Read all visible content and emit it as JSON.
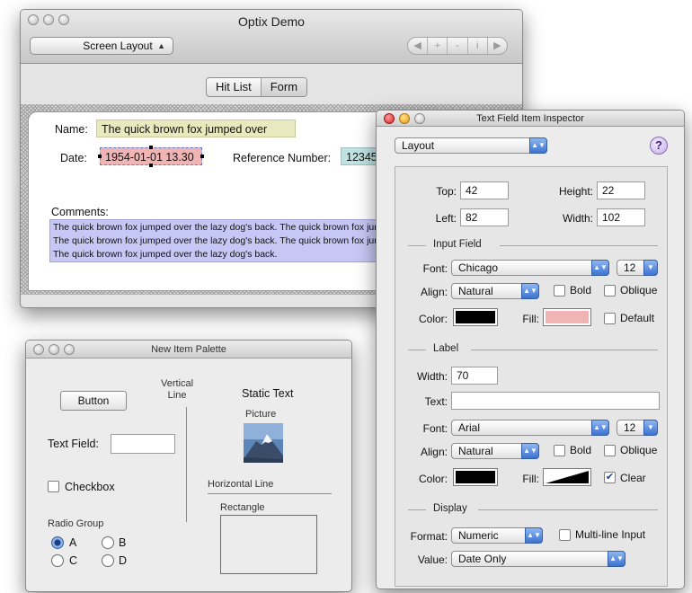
{
  "main": {
    "title": "Optix Demo",
    "layout_popup": "Screen Layout",
    "nav_segments": [
      "◀",
      "+",
      "-",
      "i",
      "▶"
    ],
    "tabs": [
      "Hit List",
      "Form"
    ],
    "form": {
      "name_label": "Name:",
      "name_value": "The quick brown fox jumped over",
      "date_label": "Date:",
      "date_value": "1954-01-01 13.30",
      "ref_label": "Reference Number:",
      "ref_value": "12345",
      "comments_label": "Comments:",
      "comments_value": "The quick brown fox jumped over the lazy dog's back.  The quick brown fox jumped over the lazy dog's back.  The quick brown fox jumped over the lazy dog's back.  The quick brown fox jumped over the lazy dog's back.  The quick brown fox jumped over the lazy dog's back."
    }
  },
  "palette": {
    "title": "New Item Palette",
    "button_label": "Button",
    "vertical_line": "Vertical\nLine",
    "static_text": "Static Text",
    "picture_label": "Picture",
    "text_field_label": "Text Field:",
    "checkbox_label": "Checkbox",
    "horizontal_line": "Horizontal Line",
    "radio_group": "Radio Group",
    "radio_a": "A",
    "radio_b": "B",
    "radio_c": "C",
    "radio_d": "D",
    "rectangle_label": "Rectangle"
  },
  "inspector": {
    "title": "Text Field Item Inspector",
    "mode_popup": "Layout",
    "help": "?",
    "top_label": "Top:",
    "top_value": "42",
    "height_label": "Height:",
    "height_value": "22",
    "left_label": "Left:",
    "left_value": "82",
    "width_label": "Width:",
    "width_value": "102",
    "input_section": "Input Field",
    "font_label": "Font:",
    "input_font": "Chicago",
    "input_size": "12",
    "align_label": "Align:",
    "input_align": "Natural",
    "bold_label": "Bold",
    "oblique_label": "Oblique",
    "color_label": "Color:",
    "fill_label": "Fill:",
    "default_label": "Default",
    "label_section": "Label",
    "label_width_label": "Width:",
    "label_width_value": "70",
    "text_label": "Text:",
    "text_value": "",
    "label_font": "Arial",
    "label_size": "12",
    "label_align": "Natural",
    "clear_label": "Clear",
    "display_section": "Display",
    "format_label": "Format:",
    "format_value": "Numeric",
    "multiline_label": "Multi-line Input",
    "value_label": "Value:",
    "value_value": "Date Only",
    "colors": {
      "input_color": "#000000",
      "input_fill": "#f0b4b4",
      "label_color": "#000000",
      "name_field_bg": "#e9e9c0",
      "date_field_bg": "#f0b4b4",
      "ref_field_bg": "#bfe3e3",
      "comments_bg": "#c7c7f5"
    }
  }
}
